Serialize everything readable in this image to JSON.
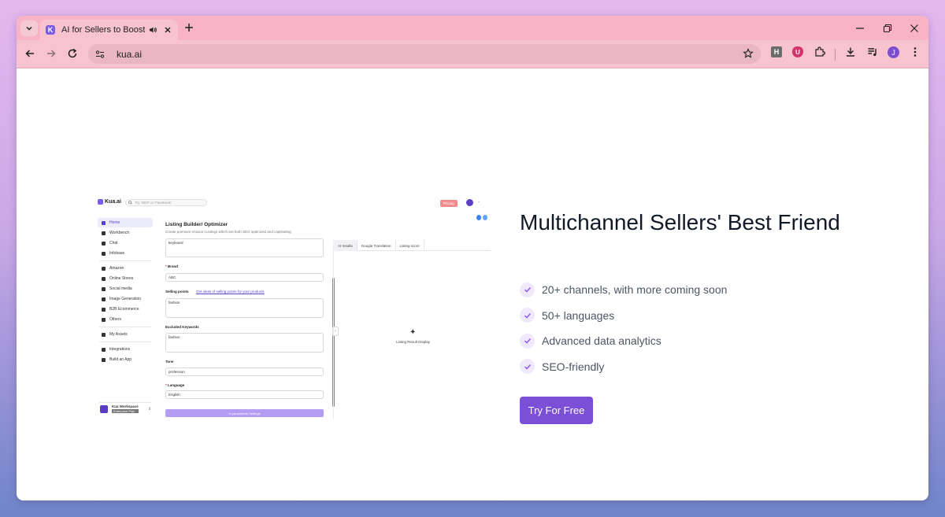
{
  "browser": {
    "tab": {
      "title": "AI for Sellers to Boost Multi",
      "favicon_letter": "K"
    },
    "address": {
      "url": "kua.ai"
    },
    "profile_initial": "J",
    "extensions": {
      "h_letter": "H",
      "u_letter": "U"
    }
  },
  "preview": {
    "logo": "Kua.ai",
    "search_placeholder": "Try 'SEO' or 'Facebook'",
    "pricing_label": "Pricing",
    "nav": [
      {
        "label": "Home"
      },
      {
        "label": "Workbench"
      },
      {
        "label": "Chat"
      },
      {
        "label": "Infobase"
      },
      {
        "label": "Amazon"
      },
      {
        "label": "Online Stores"
      },
      {
        "label": "Social media"
      },
      {
        "label": "Image Generation"
      },
      {
        "label": "B2B Ecommerce"
      },
      {
        "label": "Others"
      },
      {
        "label": "My Assets"
      },
      {
        "label": "Integrations"
      },
      {
        "label": "Build an App"
      }
    ],
    "workspace": {
      "name": "Kua Workspace",
      "plan": "Enterprise Plan"
    },
    "title": "Listing Builder/ Optimizer",
    "subtitle": "Create premium Amazon Listings which are both SEO optimized and captivating",
    "form": {
      "keyword_value": "keyboard",
      "brand_label": "Brand",
      "brand_value": "ABC",
      "selling_points_label": "Selling points",
      "selling_points_link": "Get ideas of selling points for your products",
      "selling_points_value": "fashion",
      "excluded_label": "Excluded Keywords",
      "excluded_value": "fashion",
      "tone_label": "Tone",
      "tone_value": "profession",
      "language_label": "Language",
      "language_value": "English",
      "submit_label": "In parameters Settings"
    },
    "result_tabs": [
      {
        "label": "AI results"
      },
      {
        "label": "Google Translation"
      },
      {
        "label": "Listing score"
      }
    ],
    "result_placeholder": "Listing Result Display"
  },
  "hero": {
    "title": "Multichannel Sellers' Best Friend",
    "features": [
      "20+ channels, with more coming soon",
      "50+ languages",
      "Advanced data analytics",
      "SEO-friendly"
    ],
    "cta_label": "Try For Free"
  },
  "colors": {
    "accent": "#7b4fd6",
    "tabbar": "#f8b4c4",
    "toolbar": "#f7c3ce",
    "check_bg": "#efe9fb"
  }
}
